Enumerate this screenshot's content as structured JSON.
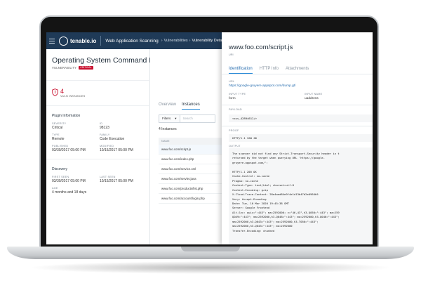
{
  "app": {
    "logo": "tenable.io",
    "product": "Web Application Scanning",
    "breadcrumb": [
      "Vulnerabilities",
      "Vulnerability Details"
    ]
  },
  "vulnerability": {
    "title": "Operating System Command Injection",
    "type_label": "VULNERABILITY",
    "severity_badge": "CRITICAL",
    "instances_count": "4",
    "instances_label": "VULN INSTANCES"
  },
  "plugin_info": {
    "heading": "Plugin Information",
    "fields": [
      {
        "label": "SEVERITY",
        "value": "Critical"
      },
      {
        "label": "ID",
        "value": "98123"
      },
      {
        "label": "TYPE",
        "value": "Remote"
      },
      {
        "label": "FAMILY",
        "value": "Code Execution"
      },
      {
        "label": "PUBLISHED",
        "value": "03/30/2017 05:00 PM"
      },
      {
        "label": "MODIFIED",
        "value": "10/15/2017 05:00 PM"
      }
    ]
  },
  "discovery": {
    "heading": "Discovery",
    "fields": [
      {
        "label": "FIRST SEEN",
        "value": "03/30/2017 05:00 PM"
      },
      {
        "label": "LAST SEEN",
        "value": "10/15/2017 05:00 PM"
      },
      {
        "label": "AGE",
        "value": "4 months and 18 days"
      }
    ]
  },
  "instances_tabs": [
    "Overview",
    "Instances"
  ],
  "filters": {
    "label": "Filters",
    "placeholder": "Search"
  },
  "instances_table": {
    "count_label": "4 Instances",
    "column": "NAME",
    "rows": [
      "www.foo.com/script.js",
      "www.foo.com/index.php",
      "www.foo.com/service.xml",
      "www.foo.com/servlet.java",
      "www.foo.com/products/list.php",
      "www.foo.com/account/login.php"
    ]
  },
  "detail": {
    "url": "www.foo.com/script.js",
    "url_label": "URI",
    "tabs": [
      "Identification",
      "HTTP Info",
      "Attachments"
    ],
    "url_field_label": "URL",
    "url_field_value": "https://google-gruyere.appspot.com/dump.gtl",
    "input_type_label": "INPUT TYPE",
    "input_type_value": "form",
    "input_name_label": "INPUT NAME",
    "input_name_value": "uaddress",
    "payload_label": "PAYLOAD",
    "payload_value": "<xss_42894612/>",
    "proof_label": "PROOF",
    "proof_value": "HTTP/1.1 200 OK",
    "output_label": "OUTPUT",
    "output_lines": [
      "The scanner did not find any Strict-Transport-Security header in t",
      "returned by the target when querying URL 'https://google-",
      "gruyere.appspot.com/':",
      "",
      "HTTP/1.1 200 OK",
      "Cache-Control: no-cache",
      "Pragma: no-cache",
      "Content-Type: text/html; charset=utf-8",
      "Content-Encoding: gzip",
      "X-Cloud-Trace-Context: 28e4aed84e9f4e1d13b47b2e0964b5",
      "Vary: Accept-Encoding",
      "Date: Tue, 10 Mar 2020 19:45:38 GMT",
      "Server: Google Frontend",
      "Alt-Svc: quic=\":443\"; ma=2592000; v=\"46,43\",h3-Q050=\":443\"; ma=259",
      "Q049=\":443\"; ma=2592000,h3-Q048=\":443\"; ma=2592000,h3-Q046=\":443\";",
      "ma=2592000,h3-Q043=\":443\"; ma=2592000,h3-T050=\":443\";",
      "ma=2592000,h3-Q043=\":443\"; ma=2592000",
      "Transfer-Encoding: chunked"
    ]
  },
  "colors": {
    "appbar": "#1f3a57",
    "critical": "#c8102e",
    "accent": "#2a8bd8"
  }
}
